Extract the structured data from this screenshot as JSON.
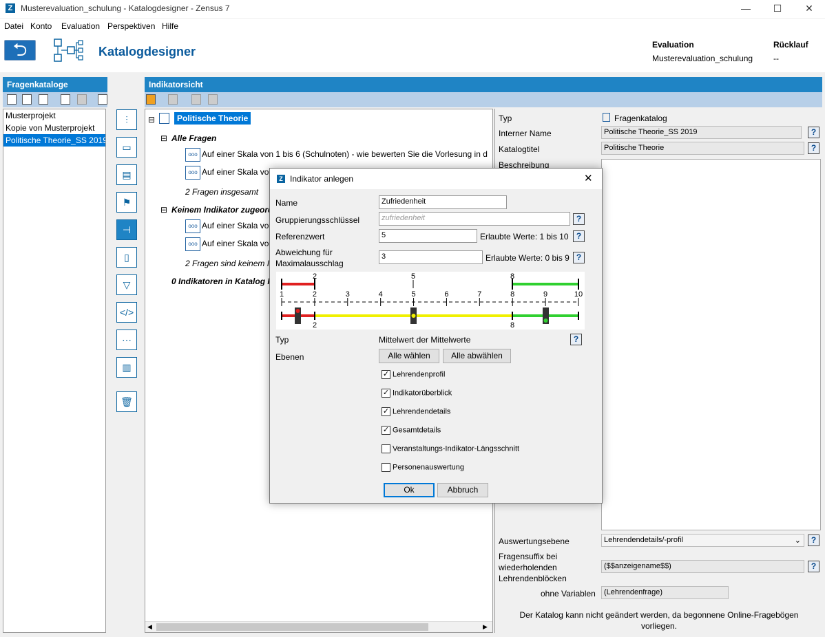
{
  "window": {
    "title": "Musterevaluation_schulung - Katalogdesigner - Zensus 7",
    "app_icon": "Z"
  },
  "menu": [
    "Datei",
    "Konto",
    "Evaluation",
    "Perspektiven",
    "Hilfe"
  ],
  "header": {
    "page_title": "Katalogdesigner",
    "evaluation_label": "Evaluation",
    "evaluation_value": "Musterevaluation_schulung",
    "ruecklauf_label": "Rücklauf",
    "ruecklauf_value": "--"
  },
  "left_panel": {
    "title": "Fragenkataloge",
    "items": [
      "Musterprojekt",
      "Kopie von Musterprojekt",
      "Politische Theorie_SS 2019"
    ]
  },
  "middle_panel": {
    "title": "Indikatorsicht",
    "tree": {
      "root": "Politische Theorie",
      "group1": "Alle Fragen",
      "q1": "Auf einer Skala von 1 bis 6 (Schulnoten) - wie bewerten Sie die Vorlesung in d",
      "q2": "Auf einer Skala vo",
      "count1": "2 Fragen insgesamt",
      "group2": "Keinem Indikator zugeord",
      "q3": "Auf einer Skala vo",
      "q4": "Auf einer Skala vo",
      "count2": "2 Fragen sind keinem I",
      "indicators": "0 Indikatoren in Katalog P"
    },
    "q_icon_text": "ooo"
  },
  "properties": {
    "typ_label": "Typ",
    "typ_value": "Fragenkatalog",
    "interner_name_label": "Interner Name",
    "interner_name_value": "Politische Theorie_SS 2019",
    "katalogtitel_label": "Katalogtitel",
    "katalogtitel_value": "Politische Theorie",
    "beschreibung_label": "Beschreibung",
    "auswertungsebene_label": "Auswertungsebene",
    "auswertungsebene_value": "Lehrendendetails/-profil",
    "fragensuffix_label_1": "Fragensuffix bei",
    "fragensuffix_label_2": "wiederholenden",
    "fragensuffix_label_3": "Lehrendenblöcken",
    "fragensuffix_value": "($$anzeigename$$)",
    "ohne_variablen_label": "ohne Variablen",
    "ohne_variablen_value": "(Lehrendenfrage)",
    "notice_1": "Der Katalog kann nicht geändert werden, da begonnene Online-Fragebögen",
    "notice_2": "vorliegen.",
    "help": "?"
  },
  "dialog": {
    "title": "Indikator anlegen",
    "close": "✕",
    "name_label": "Name",
    "name_value": "Zufriedenheit",
    "gruppierung_label": "Gruppierungsschlüssel",
    "gruppierung_placeholder": "zufriedenheit",
    "referenz_label": "Referenzwert",
    "referenz_value": "5",
    "referenz_hint": "Erlaubte Werte: 1 bis 10",
    "abweichung_label_1": "Abweichung für",
    "abweichung_label_2": "Maximalausschlag",
    "abweichung_value": "3",
    "abweichung_hint": "Erlaubte Werte: 0 bis 9",
    "scale": {
      "top_marks": [
        "2",
        "5",
        "8"
      ],
      "ticks": [
        "1",
        "2",
        "3",
        "4",
        "5",
        "6",
        "7",
        "8",
        "9",
        "10"
      ],
      "bottom_marks": [
        "2",
        "8"
      ]
    },
    "typ_label": "Typ",
    "typ_value": "Mittelwert der Mittelwerte",
    "ebenen_label": "Ebenen",
    "select_all": "Alle wählen",
    "deselect_all": "Alle abwählen",
    "checkboxes": [
      {
        "label": "Lehrendenprofil",
        "checked": true
      },
      {
        "label": "Indikatorüberblick",
        "checked": true
      },
      {
        "label": "Lehrendendetails",
        "checked": true
      },
      {
        "label": "Gesamtdetails",
        "checked": true
      },
      {
        "label": "Veranstaltungs-Indikator-Längsschnitt",
        "checked": false
      },
      {
        "label": "Personenauswertung",
        "checked": false
      }
    ],
    "ok": "Ok",
    "cancel": "Abbruch",
    "help": "?"
  },
  "colors": {
    "accent": "#1f84c5",
    "selection": "#0078d7",
    "title_blue": "#0a5a9c",
    "scale_red": "#e02020",
    "scale_yellow": "#f0f000",
    "scale_green": "#30d030"
  }
}
